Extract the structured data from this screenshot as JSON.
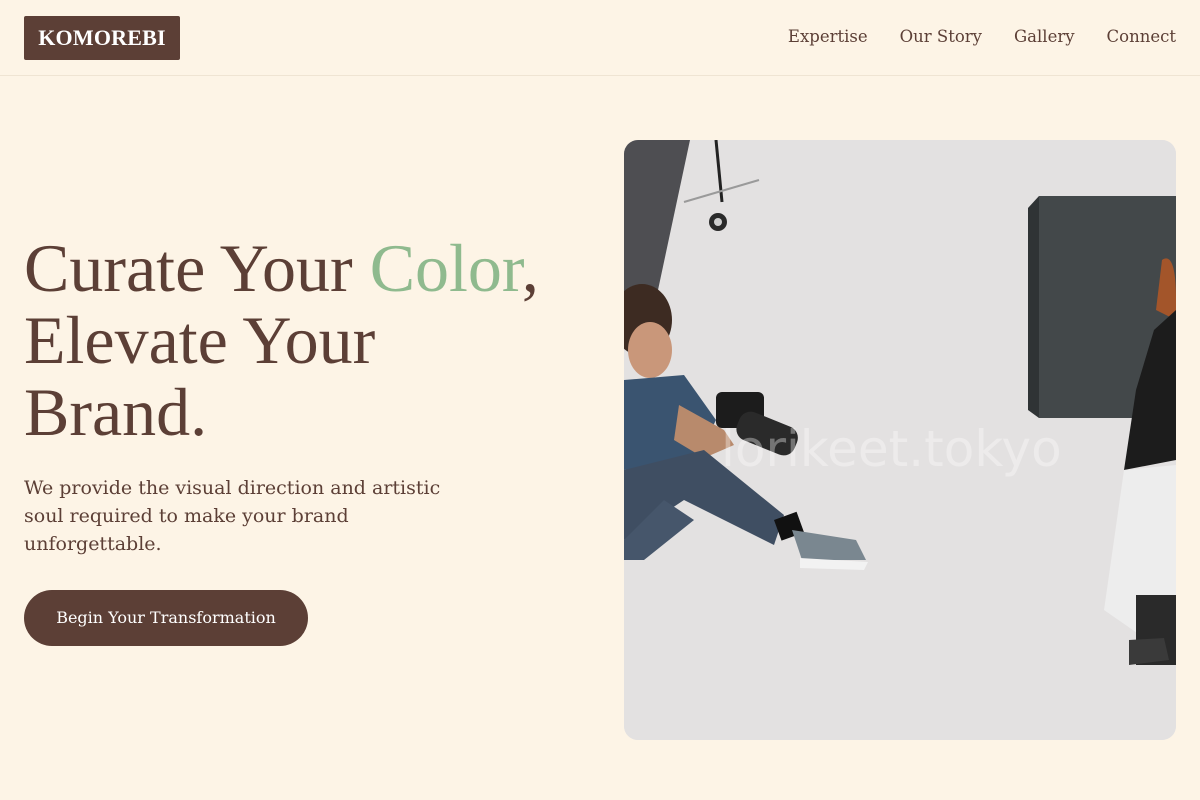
{
  "header": {
    "logo_text": "KOMOREBI",
    "nav": [
      {
        "label": "Expertise"
      },
      {
        "label": "Our Story"
      },
      {
        "label": "Gallery"
      },
      {
        "label": "Connect"
      }
    ]
  },
  "hero": {
    "title_part1": "Curate Your ",
    "title_accent": "Color",
    "title_part2": ",",
    "title_line2": "Elevate Your",
    "title_line3": "Brand.",
    "subtitle": "We provide the visual direction and artistic soul required to make your brand unforgettable.",
    "cta_label": "Begin Your Transformation"
  },
  "photo": {
    "description_icon": "photo-shoot-image",
    "watermark": "lorikeet.tokyo"
  },
  "colors": {
    "background": "#fdf4e6",
    "brand": "#5c3f36",
    "accent": "#8fba8e",
    "button_text": "#ffffff"
  }
}
